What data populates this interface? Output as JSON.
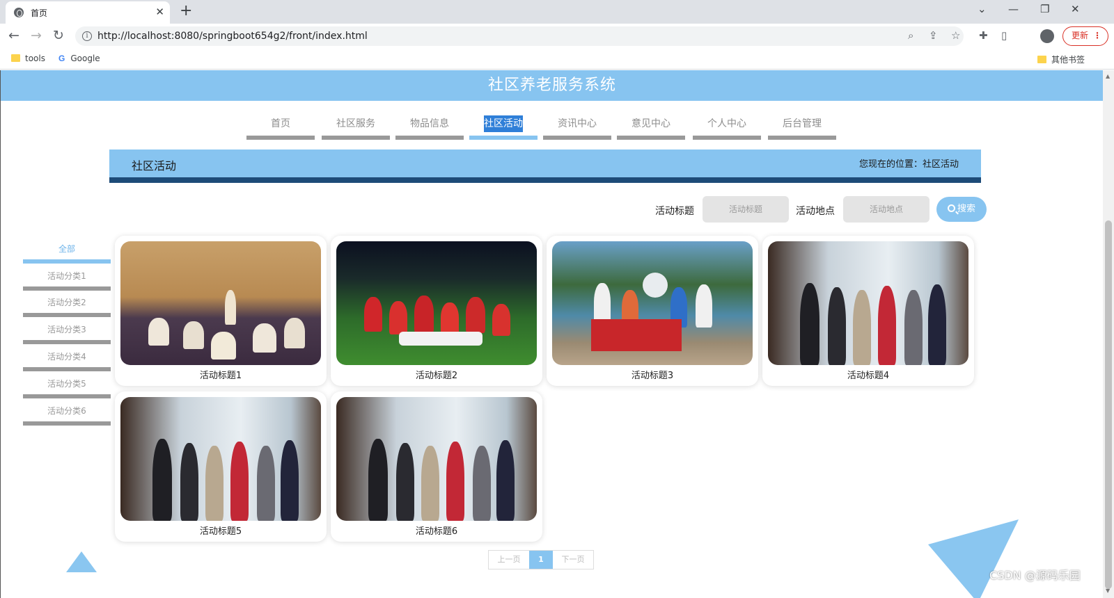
{
  "browser": {
    "tab_title": "首页",
    "url": "http://localhost:8080/springboot654g2/front/index.html",
    "update_label": "更新",
    "bookmarks": [
      "tools",
      "Google"
    ],
    "other_bookmarks": "其他书签"
  },
  "site": {
    "title": "社区养老服务系统",
    "nav": [
      "首页",
      "社区服务",
      "物品信息",
      "社区活动",
      "资讯中心",
      "意见中心",
      "个人中心",
      "后台管理"
    ],
    "active_nav": "社区活动"
  },
  "section": {
    "title": "社区活动",
    "location": "您现在的位置：社区活动"
  },
  "search": {
    "title_label": "活动标题",
    "title_placeholder": "活动标题",
    "place_label": "活动地点",
    "place_placeholder": "活动地点",
    "button": "搜索"
  },
  "categories": [
    "全部",
    "活动分类1",
    "活动分类2",
    "活动分类3",
    "活动分类4",
    "活动分类5",
    "活动分类6"
  ],
  "activities": [
    {
      "title": "活动标题1",
      "photo": "room"
    },
    {
      "title": "活动标题2",
      "photo": "field"
    },
    {
      "title": "活动标题3",
      "photo": "lake"
    },
    {
      "title": "活动标题4",
      "photo": "office"
    },
    {
      "title": "活动标题5",
      "photo": "office"
    },
    {
      "title": "活动标题6",
      "photo": "office"
    }
  ],
  "pagination": {
    "prev": "上一页",
    "current": "1",
    "next": "下一页"
  },
  "watermark": "CSDN @源码乐园",
  "colors": {
    "accent": "#87c4f0",
    "dark_bar": "#1d4b78",
    "nav_gray": "#999999"
  }
}
